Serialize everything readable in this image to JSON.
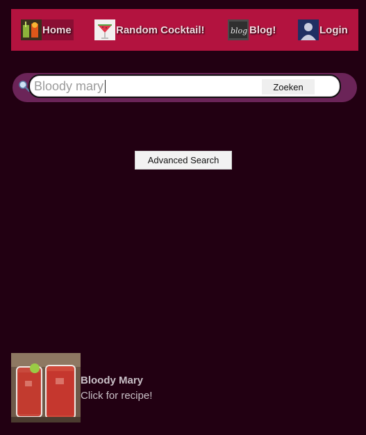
{
  "nav": {
    "items": [
      {
        "label": "Home",
        "icon": "cocktail-glasses-icon"
      },
      {
        "label": "Random Cocktail!",
        "icon": "watermelon-cocktail-icon"
      },
      {
        "label": "Blog!",
        "icon": "blog-chalkboard-icon"
      },
      {
        "label": "Login",
        "icon": "user-avatar-icon"
      }
    ]
  },
  "search": {
    "value": "Bloody mary",
    "button_label": "Zoeken",
    "icon": "search-icon"
  },
  "advanced": {
    "label": "Advanced Search"
  },
  "result": {
    "title": "Bloody Mary",
    "subtitle": "Click for recipe!",
    "image": "bloody-mary-jars-photo"
  },
  "colors": {
    "background": "#220012",
    "navbar": "#b3133f",
    "search_bar": "#6b2458"
  }
}
